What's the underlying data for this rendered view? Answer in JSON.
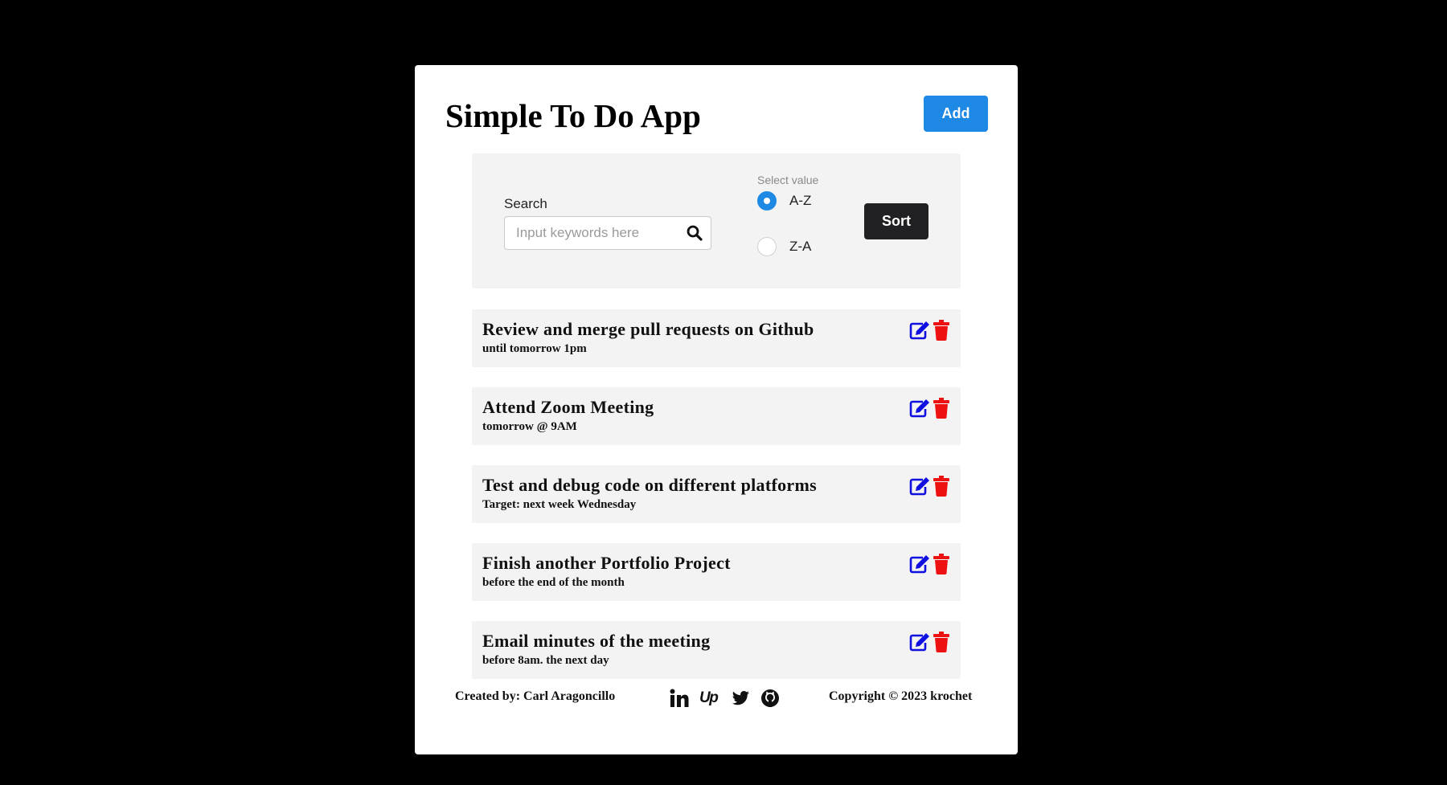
{
  "app": {
    "title": "Simple To Do App",
    "add_label": "Add"
  },
  "search": {
    "label": "Search",
    "placeholder": "Input keywords here",
    "value": ""
  },
  "sort": {
    "legend": "Select value",
    "options": [
      {
        "label": "A-Z",
        "checked": true
      },
      {
        "label": "Z-A",
        "checked": false
      }
    ],
    "button_label": "Sort"
  },
  "tasks": [
    {
      "title": "Review and merge pull requests on Github",
      "detail": "until tomorrow 1pm"
    },
    {
      "title": "Attend Zoom Meeting",
      "detail": "tomorrow @ 9AM"
    },
    {
      "title": "Test and debug code on different platforms",
      "detail": "Target: next week Wednesday"
    },
    {
      "title": "Finish another Portfolio Project",
      "detail": "before the end of the month"
    },
    {
      "title": "Email minutes of the meeting",
      "detail": "before 8am. the next day"
    }
  ],
  "footer": {
    "created_by": "Created by: Carl Aragoncillo",
    "copyright": "Copyright © 2023 krochet",
    "social_icons": [
      "linkedin-icon",
      "upwork-icon",
      "twitter-icon",
      "github-icon"
    ],
    "upwork_text": "Up"
  },
  "colors": {
    "page_background": "#000000",
    "card_background": "#ffffff",
    "panel_background": "#f3f3f3",
    "add_button": "#1e88e5",
    "sort_button": "#212124",
    "edit_icon": "#1010e0",
    "delete_icon": "#ee1111"
  }
}
